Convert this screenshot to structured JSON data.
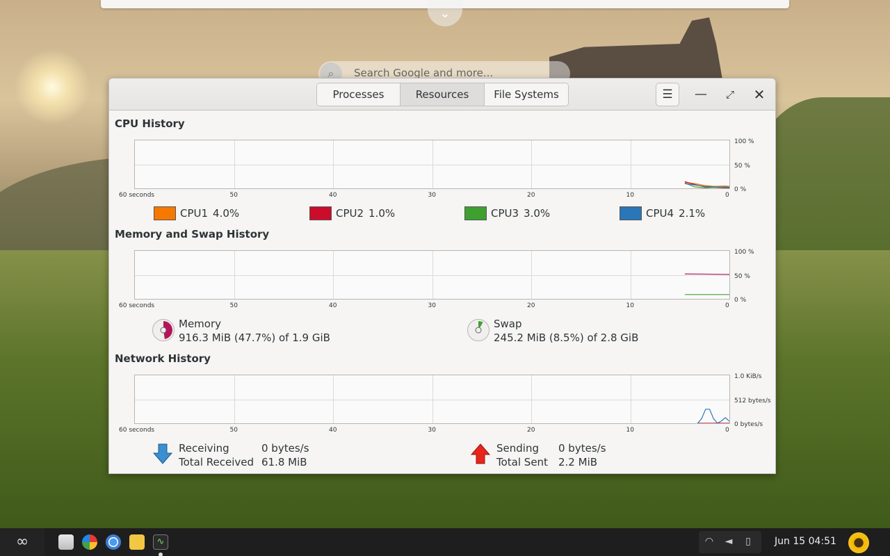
{
  "desktop": {
    "search_placeholder": "Search Google and more...",
    "expander_icon": "chevron-down-icon"
  },
  "window": {
    "tabs": [
      {
        "label": "Processes",
        "active": false
      },
      {
        "label": "Resources",
        "active": true
      },
      {
        "label": "File Systems",
        "active": false
      }
    ],
    "menu_icon": "hamburger-menu-icon"
  },
  "cpu": {
    "title": "CPU History",
    "x_ticks": [
      "60 seconds",
      "50",
      "40",
      "30",
      "20",
      "10",
      "0"
    ],
    "y_ticks": [
      "100 %",
      "50 %",
      "0 %"
    ],
    "cores": [
      {
        "name": "CPU1",
        "value": "4.0%",
        "color": "#f57900"
      },
      {
        "name": "CPU2",
        "value": "1.0%",
        "color": "#cc0c2b"
      },
      {
        "name": "CPU3",
        "value": "3.0%",
        "color": "#3ea12f"
      },
      {
        "name": "CPU4",
        "value": "2.1%",
        "color": "#2a76b8"
      }
    ]
  },
  "memory": {
    "title": "Memory and Swap History",
    "x_ticks": [
      "60 seconds",
      "50",
      "40",
      "30",
      "20",
      "10",
      "0"
    ],
    "y_ticks": [
      "100 %",
      "50 %",
      "0 %"
    ],
    "memory_label": "Memory",
    "memory_value": "916.3 MiB (47.7%) of 1.9 GiB",
    "memory_fraction": 0.477,
    "memory_color": "#b5145a",
    "swap_label": "Swap",
    "swap_value": "245.2 MiB (8.5%) of 2.8 GiB",
    "swap_fraction": 0.085,
    "swap_color": "#3ea12f"
  },
  "network": {
    "title": "Network History",
    "x_ticks": [
      "60 seconds",
      "50",
      "40",
      "30",
      "20",
      "10",
      "0"
    ],
    "y_ticks": [
      "1.0 KiB/s",
      "512 bytes/s",
      "0 bytes/s"
    ],
    "receiving_label": "Receiving",
    "receiving_value": "0 bytes/s",
    "total_received_label": "Total Received",
    "total_received_value": "61.8 MiB",
    "sending_label": "Sending",
    "sending_value": "0 bytes/s",
    "total_sent_label": "Total Sent",
    "total_sent_value": "2.2 MiB"
  },
  "taskbar": {
    "clock": "Jun 15  04:51",
    "apps": [
      "software-center-icon",
      "app-grid-icon",
      "chrome-browser-icon",
      "files-icon",
      "system-monitor-icon"
    ],
    "tray": [
      "wifi-icon",
      "volume-icon",
      "battery-icon"
    ]
  },
  "chart_data": [
    {
      "type": "line",
      "title": "CPU History",
      "x_range": [
        60,
        0
      ],
      "ylim": [
        0,
        100
      ],
      "series": [
        {
          "name": "CPU1",
          "x": [
            4.5,
            3.5,
            2.5,
            1.5,
            0.5,
            0
          ],
          "values": [
            12,
            10,
            6,
            4,
            5,
            4
          ]
        },
        {
          "name": "CPU2",
          "x": [
            4.5,
            3.5,
            2.5,
            1.5,
            0.5,
            0
          ],
          "values": [
            14,
            8,
            3,
            2,
            1,
            1
          ]
        },
        {
          "name": "CPU3",
          "x": [
            4.5,
            3.5,
            2.5,
            1.5,
            0.5,
            0
          ],
          "values": [
            11,
            3,
            1,
            2,
            3,
            3
          ]
        },
        {
          "name": "CPU4",
          "x": [
            4.5,
            3.5,
            2.5,
            1.5,
            0.5,
            0
          ],
          "values": [
            10,
            7,
            4,
            3,
            2,
            2.1
          ]
        }
      ]
    },
    {
      "type": "line",
      "title": "Memory and Swap History",
      "x_range": [
        60,
        0
      ],
      "ylim": [
        0,
        100
      ],
      "series": [
        {
          "name": "Memory",
          "x": [
            4.5,
            0
          ],
          "values": [
            52,
            51
          ]
        },
        {
          "name": "Swap",
          "x": [
            4.5,
            0
          ],
          "values": [
            9,
            9
          ]
        }
      ]
    },
    {
      "type": "line",
      "title": "Network History",
      "x_range": [
        60,
        0
      ],
      "ylim": [
        0,
        1024
      ],
      "series": [
        {
          "name": "Receiving",
          "x": [
            3.2,
            2.8,
            2.4,
            2.0,
            1.6,
            1.2,
            0.8,
            0.4,
            0
          ],
          "values": [
            0,
            100,
            300,
            300,
            100,
            0,
            50,
            120,
            40
          ]
        },
        {
          "name": "Sending",
          "x": [
            3.2,
            0
          ],
          "values": [
            0,
            0
          ]
        }
      ]
    }
  ]
}
